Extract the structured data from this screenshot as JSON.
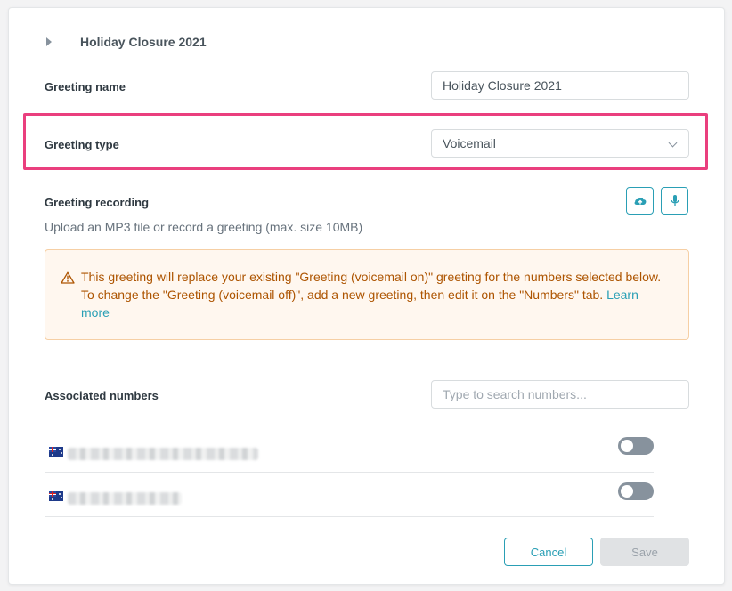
{
  "header": {
    "title": "Holiday Closure 2021"
  },
  "greeting_name": {
    "label": "Greeting name",
    "value": "Holiday Closure 2021"
  },
  "greeting_type": {
    "label": "Greeting type",
    "value": "Voicemail"
  },
  "greeting_recording": {
    "label": "Greeting recording",
    "help": "Upload an MP3 file or record a greeting (max. size 10MB)"
  },
  "alert": {
    "text": "This greeting will replace your existing \"Greeting (voicemail on)\" greeting for the numbers selected below. To change the \"Greeting (voicemail off)\", add a new greeting, then edit it on the \"Numbers\" tab.",
    "link": "Learn more"
  },
  "associated_numbers": {
    "label": "Associated numbers",
    "search_placeholder": "Type to search numbers...",
    "rows": [
      {
        "flag": "australia-flag-icon",
        "enabled": false
      },
      {
        "flag": "australia-flag-icon",
        "enabled": false
      }
    ]
  },
  "footer": {
    "cancel_label": "Cancel",
    "save_label": "Save"
  },
  "colors": {
    "accent": "#2a9fb5",
    "highlight": "#ea3f7e",
    "warning_text": "#ad5400",
    "warning_bg": "#fff7ef",
    "toggle_off": "#87929d"
  }
}
